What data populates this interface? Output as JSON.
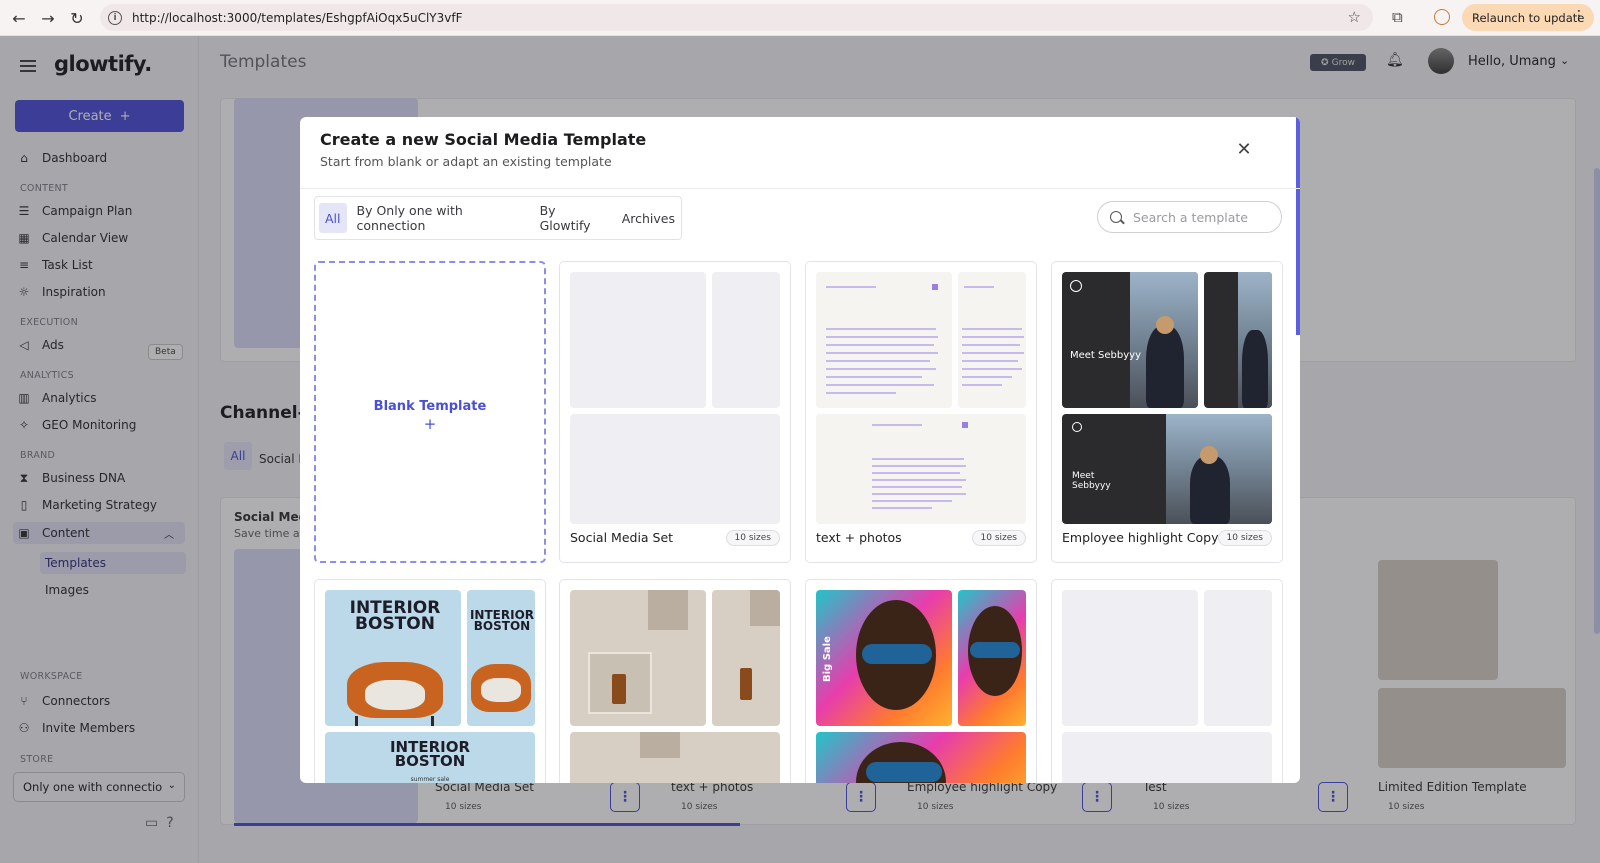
{
  "browser": {
    "url": "http://localhost:3000/templates/EshgpfAiOqx5uClY3vfF",
    "relaunch_label": "Relaunch to update"
  },
  "sidebar": {
    "logo": "glowtify.",
    "create_label": "Create",
    "items": {
      "dashboard": "Dashboard",
      "content_section": "CONTENT",
      "campaign_plan": "Campaign Plan",
      "calendar_view": "Calendar View",
      "task_list": "Task List",
      "inspiration": "Inspiration",
      "execution_section": "EXECUTION",
      "ads": "Ads",
      "beta": "Beta",
      "analytics_section": "ANALYTICS",
      "analytics": "Analytics",
      "geo_monitoring": "GEO Monitoring",
      "brand_section": "BRAND",
      "business_dna": "Business DNA",
      "marketing_strategy": "Marketing Strategy",
      "content": "Content",
      "templates": "Templates",
      "images": "Images",
      "workspace_section": "WORKSPACE",
      "connectors": "Connectors",
      "invite_members": "Invite Members",
      "store_section": "STORE"
    },
    "store_value": "Only one with connectio"
  },
  "header": {
    "page_title": "Templates",
    "grow_badge": "Grow",
    "greeting": "Hello, Umang"
  },
  "background": {
    "section_title": "Channel-s",
    "tab_all": "All",
    "tab_social": "Social I",
    "card_title": "Social Med",
    "card_sub": "Save time ar",
    "bottom_cards": [
      {
        "name": "Social Media Set",
        "sizes": "10 sizes"
      },
      {
        "name": "text + photos",
        "sizes": "10 sizes"
      },
      {
        "name": "Employee highlight Copy",
        "sizes": "10 sizes"
      },
      {
        "name": "Test",
        "sizes": "10 sizes"
      },
      {
        "name": "Limited Edition Template",
        "sizes": "10 sizes"
      }
    ]
  },
  "modal": {
    "title": "Create a new Social Media Template",
    "subtitle": "Start from blank or adapt an existing template",
    "tabs": [
      "All",
      "By Only one with connection",
      "By Glowtify",
      "Archives"
    ],
    "search_placeholder": "Search a template",
    "blank_label": "Blank Template",
    "blank_plus": "+",
    "templates": [
      {
        "name": "Social Media Set",
        "sizes": "10 sizes"
      },
      {
        "name": "text + photos",
        "sizes": "10 sizes"
      },
      {
        "name": "Employee highlight Copy",
        "sizes": "10 sizes"
      }
    ],
    "thumb_text": {
      "interior": "INTERIOR BOSTON",
      "summer": "summer sale",
      "meet": "Meet Sebbyyy",
      "big_sale": "Big Sale"
    }
  },
  "colors": {
    "accent": "#4b4fd6",
    "accent_light": "#e4e5f7"
  }
}
